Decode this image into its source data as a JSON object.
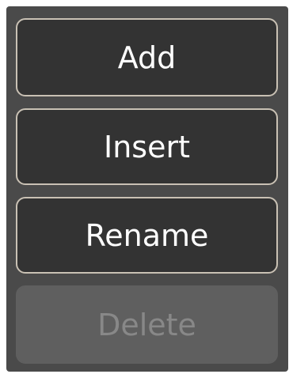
{
  "buttons": {
    "add": {
      "label": "Add",
      "enabled": true
    },
    "insert": {
      "label": "Insert",
      "enabled": true
    },
    "rename": {
      "label": "Rename",
      "enabled": true
    },
    "delete": {
      "label": "Delete",
      "enabled": false
    }
  },
  "colors": {
    "panel_bg": "#4a4a4a",
    "button_bg": "#333333",
    "button_border": "#c9c1b4",
    "button_text": "#ffffff",
    "disabled_bg": "#5f5f5f",
    "disabled_text": "#888888"
  }
}
